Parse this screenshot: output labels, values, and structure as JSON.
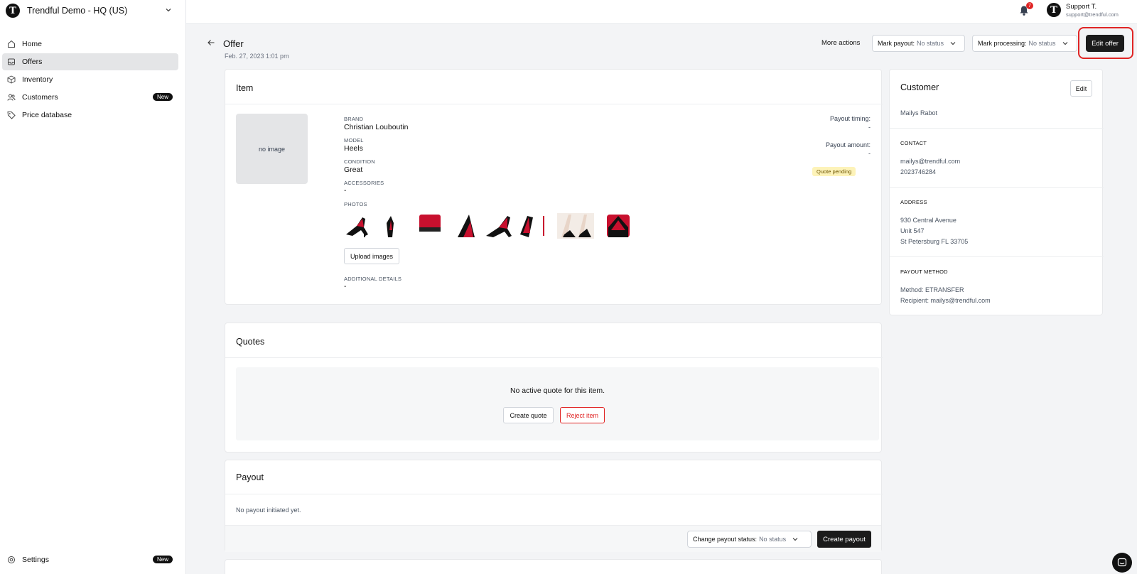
{
  "org": {
    "name": "Trendful Demo - HQ (US)",
    "logo_letter": "T"
  },
  "sidebar": {
    "items": [
      {
        "label": "Home",
        "icon": "home-icon",
        "active": false
      },
      {
        "label": "Offers",
        "icon": "inbox-icon",
        "active": true
      },
      {
        "label": "Inventory",
        "icon": "box-icon",
        "active": false
      },
      {
        "label": "Customers",
        "icon": "users-icon",
        "active": false,
        "badge": "New"
      },
      {
        "label": "Price database",
        "icon": "tag-icon",
        "active": false
      }
    ],
    "settings": {
      "label": "Settings",
      "badge": "New"
    }
  },
  "topbar": {
    "notification_count": "7",
    "user": {
      "initial": "T",
      "name": "Support T.",
      "email": "support@trendful.com"
    }
  },
  "header": {
    "title": "Offer",
    "date": "Feb. 27, 2023 1:01 pm",
    "more_actions": "More actions",
    "mark_payout_label": "Mark payout:",
    "mark_payout_value": "No status",
    "mark_processing_label": "Mark processing:",
    "mark_processing_value": "No status",
    "edit_offer": "Edit offer"
  },
  "item": {
    "title": "Item",
    "no_image": "no image",
    "brand_label": "BRAND",
    "brand": "Christian Louboutin",
    "model_label": "MODEL",
    "model": "Heels",
    "condition_label": "CONDITION",
    "condition": "Great",
    "accessories_label": "ACCESSORIES",
    "accessories": "-",
    "photos_label": "PHOTOS",
    "upload_images": "Upload images",
    "additional_label": "ADDITIONAL DETAILS",
    "additional": "-",
    "payout_timing_label": "Payout timing:",
    "payout_timing": "-",
    "payout_amount_label": "Payout amount:",
    "payout_amount": "-",
    "status_badge": "Quote pending"
  },
  "quotes": {
    "title": "Quotes",
    "empty": "No active quote for this item.",
    "create_quote": "Create quote",
    "reject_item": "Reject item"
  },
  "payout": {
    "title": "Payout",
    "empty": "No payout initiated yet.",
    "change_label": "Change payout status:",
    "change_value": "No status",
    "create_payout": "Create payout"
  },
  "customer": {
    "title": "Customer",
    "edit": "Edit",
    "name": "Mailys Rabot",
    "contact_label": "CONTACT",
    "email": "mailys@trendful.com",
    "phone": "2023746284",
    "address_label": "ADDRESS",
    "address_line1": "930 Central Avenue",
    "address_line2": "Unit 547",
    "address_line3": "St Petersburg FL 33705",
    "payout_method_label": "PAYOUT METHOD",
    "method": "Method: ETRANSFER",
    "recipient": "Recipient: mailys@trendful.com"
  },
  "colors": {
    "accent_dark": "#1b1b1b",
    "danger": "#e02424",
    "pending_bg": "#fdf3b9"
  }
}
